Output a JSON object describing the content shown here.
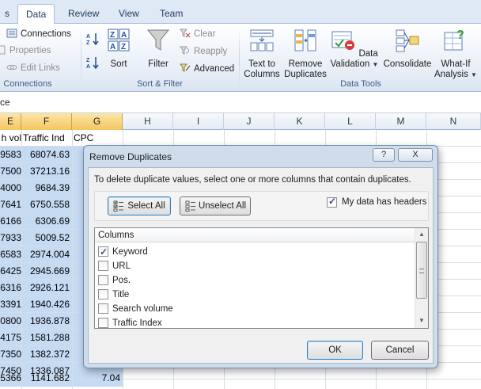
{
  "ribbon_tabs": [
    "s",
    "Data",
    "Review",
    "View",
    "Team"
  ],
  "active_tab": "Data",
  "connections_group": {
    "connections": "Connections",
    "properties": "Properties",
    "edit_links": "Edit Links",
    "label": "Connections"
  },
  "sort_filter_group": {
    "sort": "Sort",
    "filter": "Filter",
    "clear": "Clear",
    "reapply": "Reapply",
    "advanced": "Advanced",
    "label": "Sort & Filter"
  },
  "data_tools_group": {
    "text_to_columns_1": "Text to",
    "text_to_columns_2": "Columns",
    "remove_duplicates_1": "Remove",
    "remove_duplicates_2": "Duplicates",
    "data_validation_1": "Data",
    "data_validation_2": "Validation",
    "consolidate": "Consolidate",
    "what_if_1": "What-If",
    "what_if_2": "Analysis",
    "label": "Data Tools"
  },
  "formula_bar": {
    "text": "ce"
  },
  "columns": [
    "E",
    "F",
    "G",
    "H",
    "I",
    "J",
    "K",
    "L",
    "M",
    "N"
  ],
  "header_row": [
    "h vol",
    "Traffic Ind",
    "CPC"
  ],
  "rows": [
    [
      "9583",
      "68074.63",
      ""
    ],
    [
      "7500",
      "37213.16",
      ""
    ],
    [
      "4000",
      "9684.39",
      ""
    ],
    [
      "7641",
      "6750.558",
      ""
    ],
    [
      "6166",
      "6306.69",
      ""
    ],
    [
      "7933",
      "5009.52",
      ""
    ],
    [
      "6583",
      "2974.004",
      ""
    ],
    [
      "6425",
      "2945.669",
      ""
    ],
    [
      "6316",
      "2926.121",
      ""
    ],
    [
      "3391",
      "1940.426",
      ""
    ],
    [
      "0800",
      "1936.878",
      ""
    ],
    [
      "4175",
      "1581.288",
      ""
    ],
    [
      "7350",
      "1382.372",
      ""
    ],
    [
      "7450",
      "1336.087",
      ""
    ],
    [
      "5366",
      "1141.682",
      "7.04"
    ]
  ],
  "dialog": {
    "title": "Remove Duplicates",
    "help": "?",
    "close": "X",
    "instruction": "To delete duplicate values, select one or more columns that contain duplicates.",
    "select_all": "Select All",
    "unselect_all": "Unselect All",
    "headers_label": "My data has headers",
    "headers_checked": true,
    "columns_header": "Columns",
    "items": [
      {
        "label": "Keyword",
        "checked": true
      },
      {
        "label": "URL",
        "checked": false
      },
      {
        "label": "Pos.",
        "checked": false
      },
      {
        "label": "Title",
        "checked": false
      },
      {
        "label": "Search volume",
        "checked": false
      },
      {
        "label": "Traffic Index",
        "checked": false
      }
    ],
    "ok": "OK",
    "cancel": "Cancel"
  }
}
